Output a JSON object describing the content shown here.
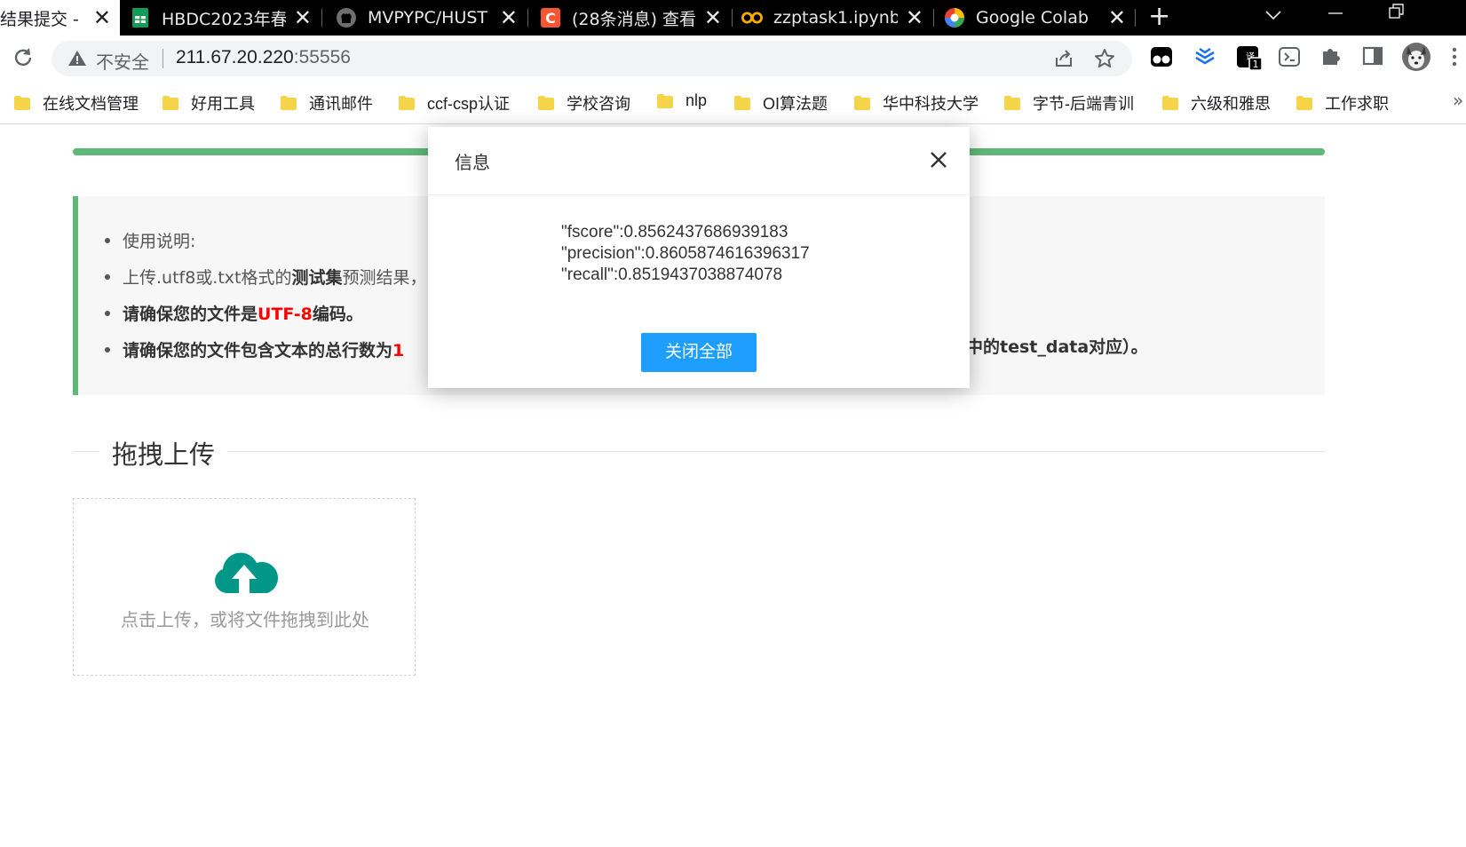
{
  "browser": {
    "tabs": [
      {
        "title": "结果提交 - |",
        "favicon": "page-icon"
      },
      {
        "title": "HBDC2023年春",
        "favicon": "sheets-icon"
      },
      {
        "title": "MVPYPC/HUST",
        "favicon": "github-icon"
      },
      {
        "title": "(28条消息) 查看",
        "favicon": "csdn-icon"
      },
      {
        "title": "zzptask1.ipynb",
        "favicon": "colab-icon"
      },
      {
        "title": "Google Colab",
        "favicon": "google-colab-icon"
      }
    ],
    "new_tab": "+",
    "address": {
      "security_label": "不安全",
      "host": "211.67.20.220",
      "port": ":55556"
    },
    "extension_badge": "1"
  },
  "bookmarks": [
    "在线文档管理",
    "好用工具",
    "通讯邮件",
    "ccf-csp认证",
    "学校咨询",
    "nlp",
    "OI算法题",
    "华中科技大学",
    "字节-后端青训",
    "六级和雅思",
    "工作求职"
  ],
  "bookmarks_more": "»",
  "page": {
    "colors": {
      "accent_green": "#5fb878",
      "button_blue": "#1e9fff",
      "warning_red": "#ff0000"
    },
    "instructions": {
      "item1": "使用说明:",
      "item2_prefix": "上传.utf8或.txt格式的",
      "item2_bold": "测试集",
      "item2_suffix": "预测结果，",
      "item3_prefix": "请确保您的文件是",
      "item3_red": "UTF-8",
      "item3_suffix": "编码。",
      "item4_prefix": "请确保您的文件包含文本的总行数为",
      "item4_red": "1",
      "item4_tail": "中的test_data对应）。"
    },
    "upload": {
      "legend": "拖拽上传",
      "hint": "点击上传，或将文件拖拽到此处"
    }
  },
  "dialog": {
    "title": "信息",
    "lines": [
      "\"fscore\":0.8562437686939183",
      "\"precision\":0.8605874616396317",
      "\"recall\":0.8519437038874078"
    ],
    "button": "关闭全部"
  }
}
